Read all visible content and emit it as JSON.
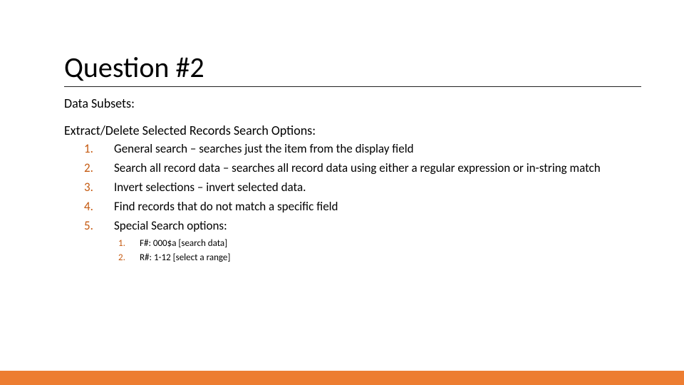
{
  "title": "Question #2",
  "heading1": "Data Subsets:",
  "heading2": "Extract/Delete Selected Records Search Options:",
  "main_list": [
    "General search – searches just the item from the display field",
    "Search all record data – searches all record data using either a regular expression or in-string match",
    "Invert selections – invert selected data.",
    "Find records that do not match a specific field",
    "Special Search options:"
  ],
  "sub_list": [
    "F#: 000$a [search data]",
    "R#: 1-12 [select a range]"
  ],
  "colors": {
    "accent": "#ed7d31",
    "number": "#c55a11"
  }
}
